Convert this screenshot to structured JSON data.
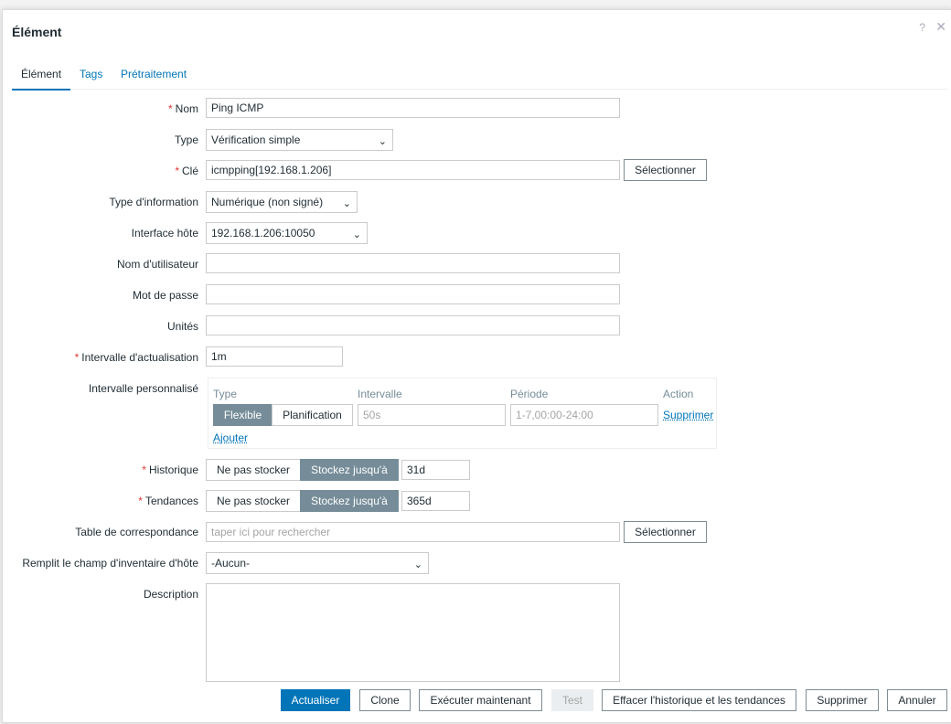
{
  "dialog": {
    "title": "Élément",
    "help": "?",
    "close": "✕"
  },
  "tabs": [
    "Élément",
    "Tags",
    "Prétraitement"
  ],
  "form": {
    "name": {
      "label": "Nom",
      "value": "Ping ICMP"
    },
    "type": {
      "label": "Type",
      "value": "Vérification simple"
    },
    "key": {
      "label": "Clé",
      "value": "icmpping[192.168.1.206]",
      "button": "Sélectionner"
    },
    "info_type": {
      "label": "Type d'information",
      "value": "Numérique (non signé)"
    },
    "host_iface": {
      "label": "Interface hôte",
      "value": "192.168.1.206:10050"
    },
    "username": {
      "label": "Nom d'utilisateur",
      "value": ""
    },
    "password": {
      "label": "Mot de passe",
      "value": ""
    },
    "units": {
      "label": "Unités",
      "value": ""
    },
    "update_interval": {
      "label": "Intervalle d'actualisation",
      "value": "1m"
    },
    "custom_interval": {
      "label": "Intervalle personnalisé",
      "headers": [
        "Type",
        "Intervalle",
        "Période",
        "Action"
      ],
      "seg_flexible": "Flexible",
      "seg_schedule": "Planification",
      "interval_placeholder": "50s",
      "period_placeholder": "1-7,00:00-24:00",
      "remove": "Supprimer",
      "add": "Ajouter"
    },
    "history": {
      "label": "Historique",
      "opt_off": "Ne pas stocker",
      "opt_on": "Stockez jusqu'à",
      "value": "31d"
    },
    "trends": {
      "label": "Tendances",
      "opt_off": "Ne pas stocker",
      "opt_on": "Stockez jusqu'à",
      "value": "365d"
    },
    "valuemap": {
      "label": "Table de correspondance",
      "placeholder": "taper ici pour rechercher",
      "button": "Sélectionner"
    },
    "inventory": {
      "label": "Remplit le champ d'inventaire d'hôte",
      "value": "-Aucun-"
    },
    "description": {
      "label": "Description",
      "value": ""
    }
  },
  "footer": {
    "update": "Actualiser",
    "clone": "Clone",
    "execute": "Exécuter maintenant",
    "test": "Test",
    "clear": "Effacer l'historique et les tendances",
    "delete": "Supprimer",
    "cancel": "Annuler"
  },
  "colors": {
    "accent": "#0275b8",
    "required": "#e33734",
    "segment_on": "#768d99"
  }
}
